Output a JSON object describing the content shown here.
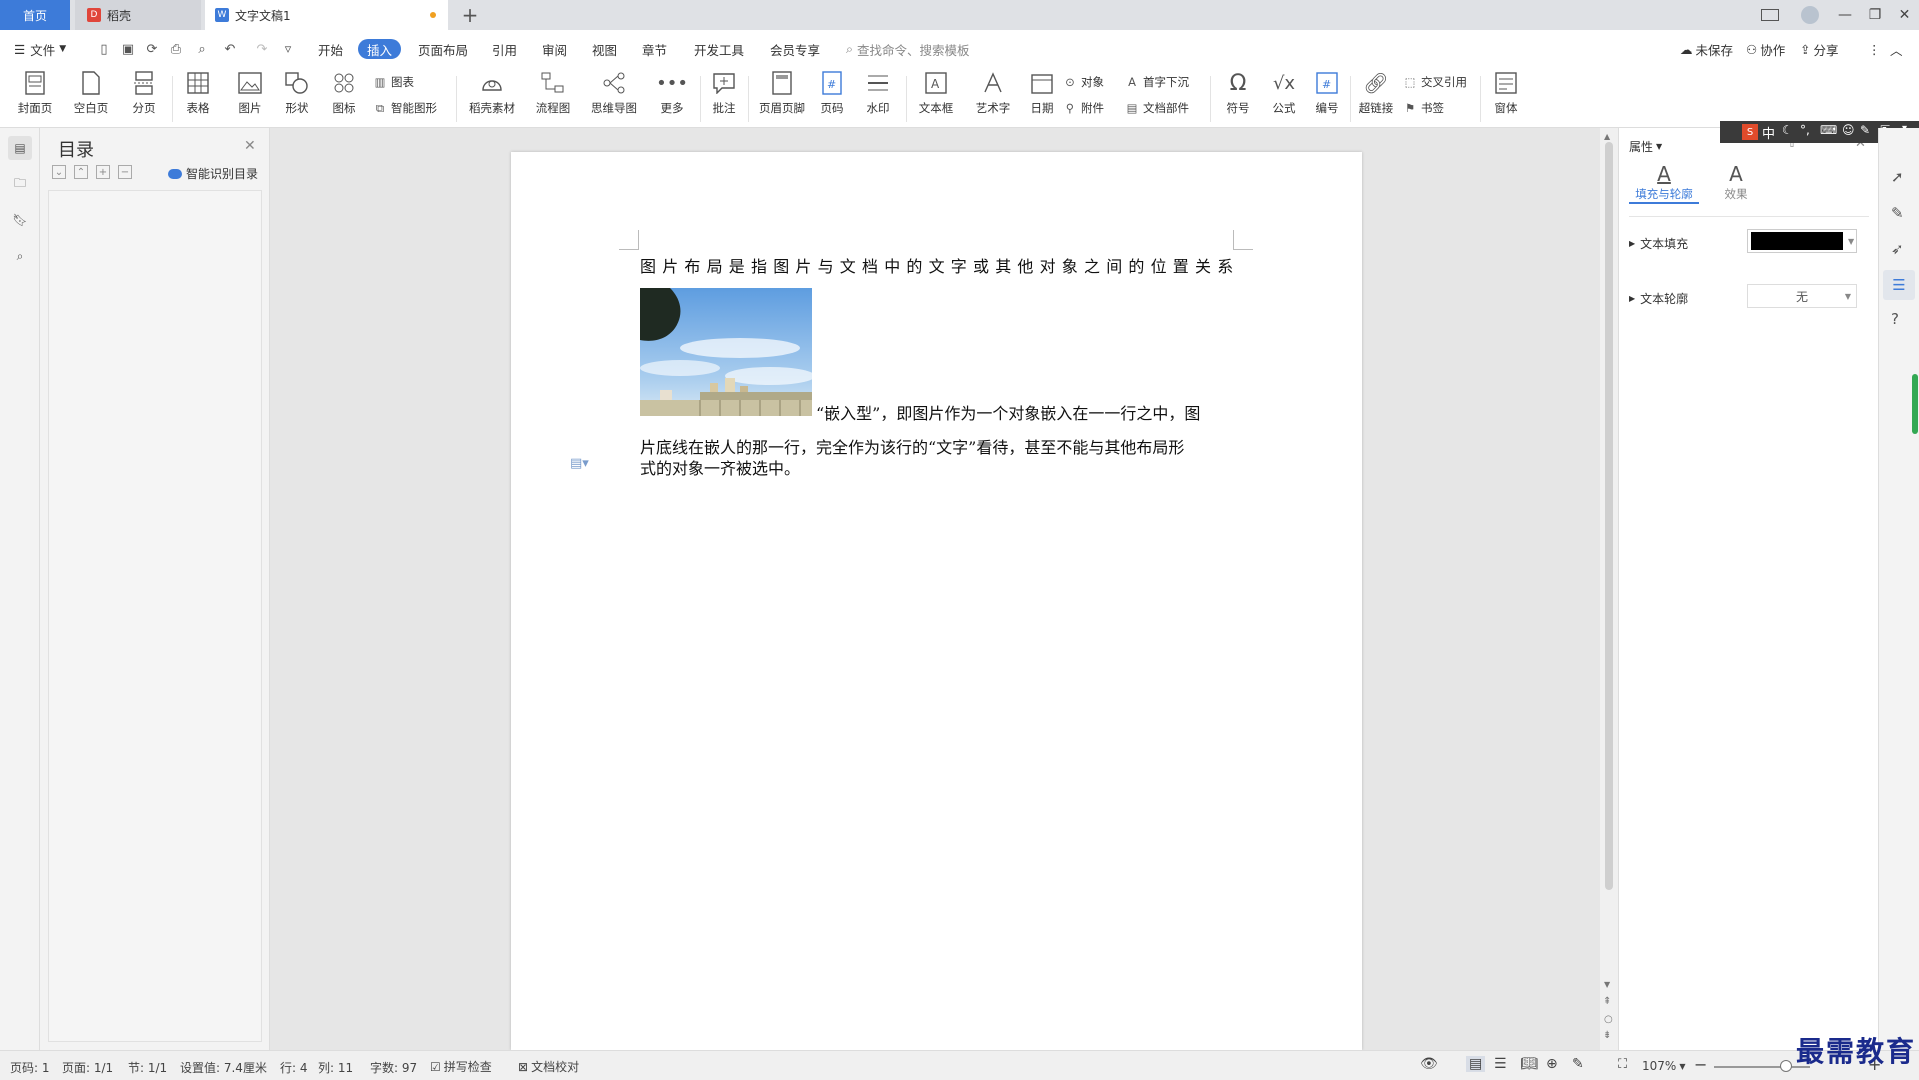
{
  "tabs": {
    "home": "首页",
    "daoke": "稻壳",
    "doc": "文字文稿1",
    "add": "+"
  },
  "menu": {
    "file": "文件",
    "items": [
      "开始",
      "插入",
      "页面布局",
      "引用",
      "审阅",
      "视图",
      "章节",
      "开发工具",
      "会员专享"
    ],
    "search_placeholder": "查找命令、搜索模板",
    "unsaved": "未保存",
    "collab": "协作",
    "share": "分享"
  },
  "ribbon": {
    "cover": "封面页",
    "blank": "空白页",
    "pagebreak": "分页",
    "table": "表格",
    "picture": "图片",
    "shape": "形状",
    "icon": "图标",
    "chart": "图表",
    "smartart": "智能图形",
    "daoke_material": "稻壳素材",
    "flowchart": "流程图",
    "mindmap": "思维导图",
    "more": "更多",
    "comment": "批注",
    "header_footer": "页眉页脚",
    "page_number": "页码",
    "watermark": "水印",
    "textbox": "文本框",
    "wordart": "艺术字",
    "date": "日期",
    "object": "对象",
    "attachment": "附件",
    "dropcap": "首字下沉",
    "doc_parts": "文档部件",
    "symbol": "符号",
    "formula": "公式",
    "numbering": "编号",
    "hyperlink": "超链接",
    "crossref": "交叉引用",
    "bookmark": "书签",
    "window": "窗体"
  },
  "toc": {
    "title": "目录",
    "smart": "智能识别目录"
  },
  "document": {
    "line1": "图片布局是指图片与文档中的文字或其他对象之间的位置关系",
    "line2": "“嵌入型”，即图片作为一个对象嵌入在一一行之中，图",
    "line3": "片底线在嵌人的那一行，完全作为该行的“文字”看待，甚至不能与其他布局形",
    "line4": "式的对象一齐被选中。"
  },
  "rpanel": {
    "title": "属性",
    "tab_fill": "填充与轮廓",
    "tab_effect": "效果",
    "text_fill": "文本填充",
    "text_outline": "文本轮廓",
    "outline_value": "无",
    "fill_color": "#000000"
  },
  "ime": {
    "zh": "中"
  },
  "status": {
    "page": "页码: 1",
    "pages": "页面: 1/1",
    "section": "节: 1/1",
    "setting": "设置值: 7.4厘米",
    "row": "行: 4",
    "col": "列: 11",
    "words": "字数: 97",
    "spell": "拼写检查",
    "proof": "文档校对",
    "zoom": "107%"
  },
  "watermark": "最需教育",
  "colors": {
    "accent": "#3d7bd9",
    "tab_dot": "#f0a020"
  }
}
